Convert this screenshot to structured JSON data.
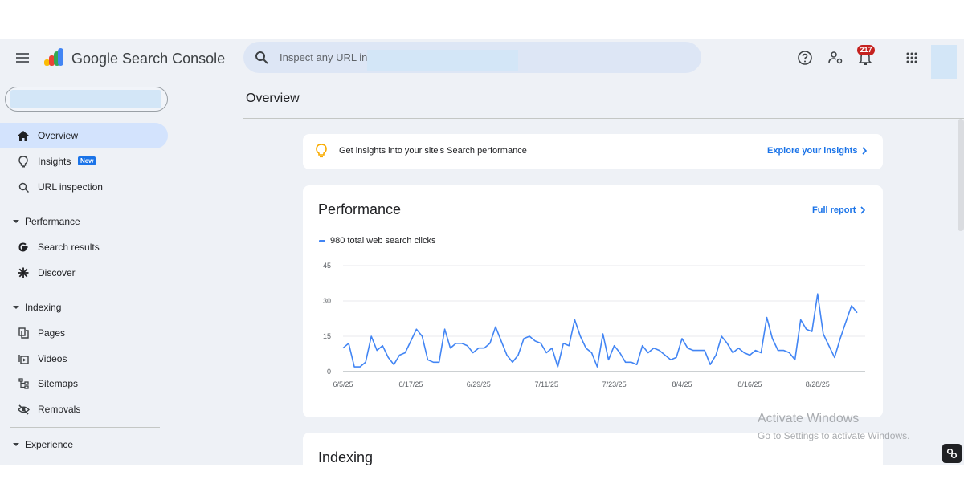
{
  "header": {
    "app_title": "Google Search Console",
    "search_placeholder": "Inspect any URL in",
    "notification_count": "217",
    "icons": [
      "menu-icon",
      "search-icon",
      "help-icon",
      "manage-users-icon",
      "notifications-icon",
      "apps-grid-icon"
    ]
  },
  "sidebar": {
    "items": [
      {
        "label": "Overview",
        "icon": "home-icon",
        "active": true
      },
      {
        "label": "Insights",
        "icon": "lightbulb-icon",
        "badge": "New"
      },
      {
        "label": "URL inspection",
        "icon": "search-icon"
      }
    ],
    "sections": [
      {
        "label": "Performance",
        "items": [
          {
            "label": "Search results",
            "icon": "google-g-icon"
          },
          {
            "label": "Discover",
            "icon": "asterisk-icon"
          }
        ]
      },
      {
        "label": "Indexing",
        "items": [
          {
            "label": "Pages",
            "icon": "pages-icon"
          },
          {
            "label": "Videos",
            "icon": "video-icon"
          },
          {
            "label": "Sitemaps",
            "icon": "sitemap-icon"
          },
          {
            "label": "Removals",
            "icon": "visibility-off-icon"
          }
        ]
      },
      {
        "label": "Experience",
        "items": []
      }
    ]
  },
  "main": {
    "page_title": "Overview",
    "insight_banner": {
      "text": "Get insights into your site's Search performance",
      "link": "Explore your insights"
    },
    "performance": {
      "title": "Performance",
      "link": "Full report",
      "legend": "980 total web search clicks"
    },
    "indexing": {
      "title": "Indexing"
    }
  },
  "watermark": {
    "line1": "Activate Windows",
    "line2": "Go to Settings to activate Windows."
  },
  "colors": {
    "accent": "#1a73e8",
    "series": "#4285f4",
    "badge": "#c5221f",
    "background": "#eef1f6"
  },
  "chart_data": {
    "type": "line",
    "title": "",
    "xlabel": "",
    "ylabel": "",
    "ylim": [
      0,
      45
    ],
    "yticks": [
      0,
      15,
      30,
      45
    ],
    "xtick_labels": [
      "6/5/25",
      "6/17/25",
      "6/29/25",
      "7/11/25",
      "7/23/25",
      "8/4/25",
      "8/16/25",
      "8/28/25"
    ],
    "grid": true,
    "series": [
      {
        "name": "980 total web search clicks",
        "values": [
          10,
          12,
          2,
          2,
          4,
          15,
          9,
          11,
          6,
          3,
          7,
          8,
          13,
          18,
          15,
          5,
          4,
          4,
          18,
          10,
          12,
          12,
          11,
          8,
          10,
          10,
          12,
          19,
          13,
          7,
          4,
          7,
          14,
          15,
          13,
          12,
          8,
          10,
          2,
          12,
          11,
          22,
          15,
          10,
          8,
          2,
          16,
          5,
          11,
          8,
          4,
          4,
          3,
          11,
          8,
          10,
          9,
          7,
          5,
          6,
          14,
          10,
          9,
          9,
          9,
          3,
          7,
          15,
          12,
          8,
          10,
          8,
          7,
          9,
          8,
          23,
          14,
          9,
          9,
          8,
          5,
          22,
          18,
          17,
          33,
          16,
          11,
          6,
          14,
          21,
          28,
          25
        ]
      }
    ]
  }
}
